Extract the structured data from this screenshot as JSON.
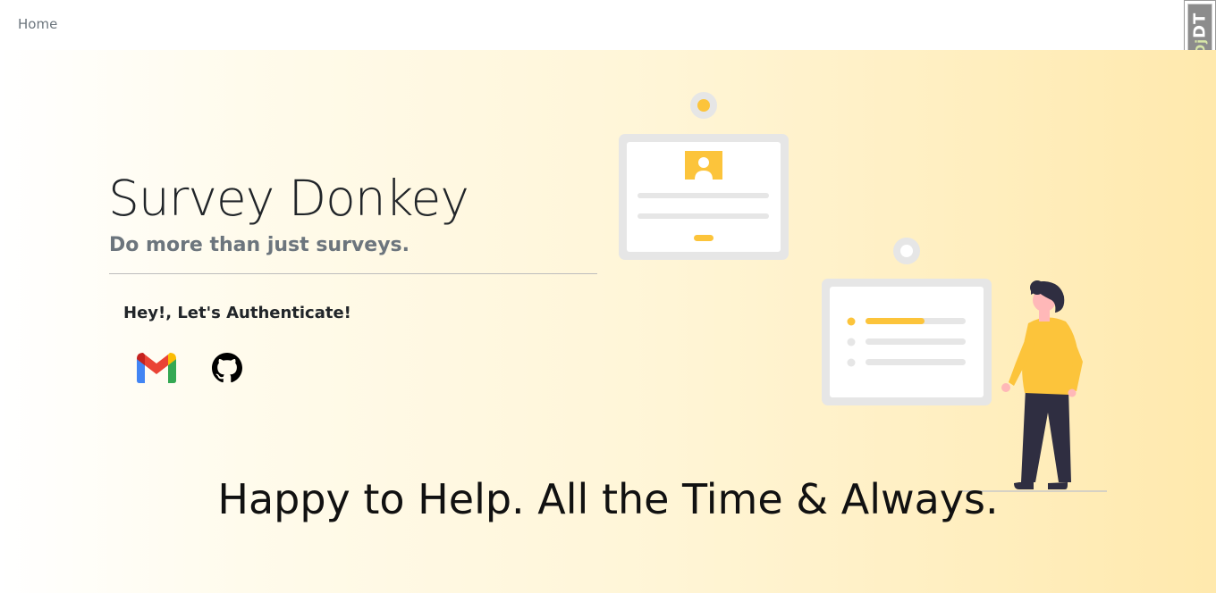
{
  "nav": {
    "home_label": "Home"
  },
  "debug_toolbar": {
    "handle_prefix": "Dj",
    "handle_suffix": "DT"
  },
  "hero": {
    "title": "Survey Donkey",
    "subtitle": "Do more than just surveys.",
    "auth_heading": "Hey!, Let's Authenticate!",
    "tagline": "Happy to Help. All the Time & Always."
  },
  "auth_providers": [
    {
      "name": "Gmail",
      "icon": "gmail-icon"
    },
    {
      "name": "GitHub",
      "icon": "github-icon"
    }
  ],
  "colors": {
    "accent": "#fcc43b",
    "text": "#212529",
    "muted": "#6c757d"
  }
}
